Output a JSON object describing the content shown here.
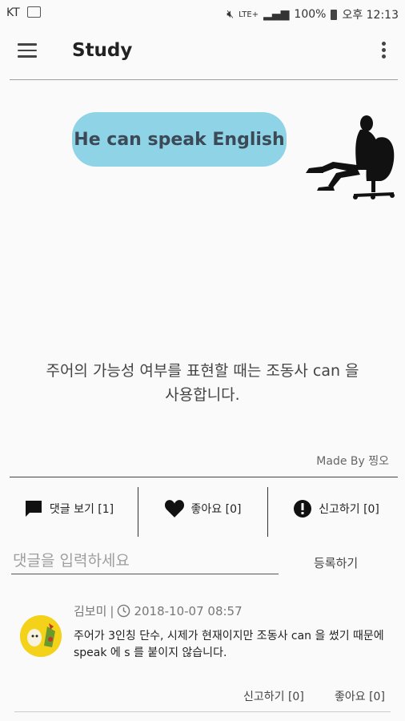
{
  "status_bar": {
    "carrier": "KT",
    "battery": "100%",
    "time": "오후 12:13",
    "network": "LTE+"
  },
  "toolbar": {
    "title": "Study"
  },
  "study": {
    "sentence": "He can speak English",
    "explanation_line1": "주어의 가능성 여부를 표현할 때는 조동사 can 을",
    "explanation_line2": "사용합니다.",
    "made_by": "Made By 찡오"
  },
  "actions": {
    "view_comments": "댓글 보기 [1]",
    "like": "좋아요 [0]",
    "report": "신고하기 [0]"
  },
  "comment_input": {
    "placeholder": "댓글을 입력하세요",
    "submit_label": "등록하기"
  },
  "comments": [
    {
      "author": "김보미",
      "separator": "|",
      "timestamp": "2018-10-07 08:57",
      "text": "주어가 3인칭 단수, 시제가 현재이지만 조동사 can 을 썼기 때문에 speak 에 s 를 붙이지 않습니다.",
      "report_label": "신고하기 [0]",
      "like_label": "좋아요 [0]"
    }
  ],
  "colors": {
    "bubble": "#8fd3e7",
    "bubble_text": "#3b4a56"
  }
}
